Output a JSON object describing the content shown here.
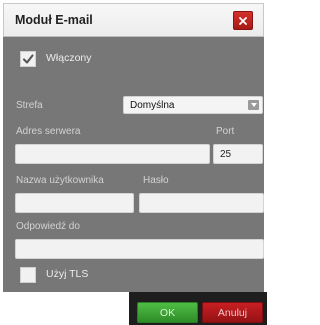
{
  "dialog": {
    "title": "Moduł E-mail"
  },
  "enabled": {
    "label": "Włączony",
    "checked": true
  },
  "zone": {
    "label": "Strefa",
    "value": "Domyślna"
  },
  "server": {
    "label": "Adres serwera",
    "value": ""
  },
  "port": {
    "label": "Port",
    "value": "25"
  },
  "username": {
    "label": "Nazwa użytkownika",
    "value": ""
  },
  "password": {
    "label": "Hasło",
    "value": ""
  },
  "reply_to": {
    "label": "Odpowiedź do",
    "value": ""
  },
  "tls": {
    "label": "Użyj TLS",
    "checked": false
  },
  "buttons": {
    "ok": "OK",
    "cancel": "Anuluj"
  },
  "colors": {
    "panel_bg": "#777777",
    "ok": "#3ca534",
    "cancel": "#b8191c",
    "close": "#c1241f"
  },
  "icons": {
    "close": "close-icon",
    "check": "checkmark-icon",
    "dropdown": "chevron-down-icon"
  }
}
